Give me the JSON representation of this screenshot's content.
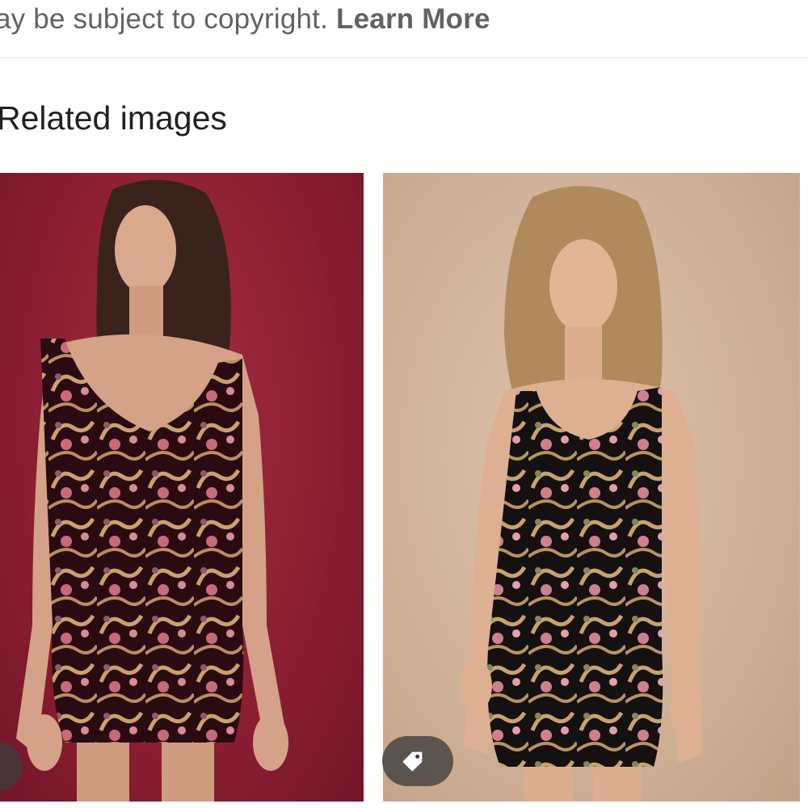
{
  "notice": {
    "text": "ay be subject to copyright.",
    "learn_more": "Learn More"
  },
  "section": {
    "title": "Related images"
  },
  "related_images": [
    {
      "background": "#8d1f33",
      "dress": "#2a0c12"
    },
    {
      "background": "#cfb198",
      "dress": "#141011"
    }
  ],
  "icons": {
    "tag": "price-tag-icon"
  }
}
